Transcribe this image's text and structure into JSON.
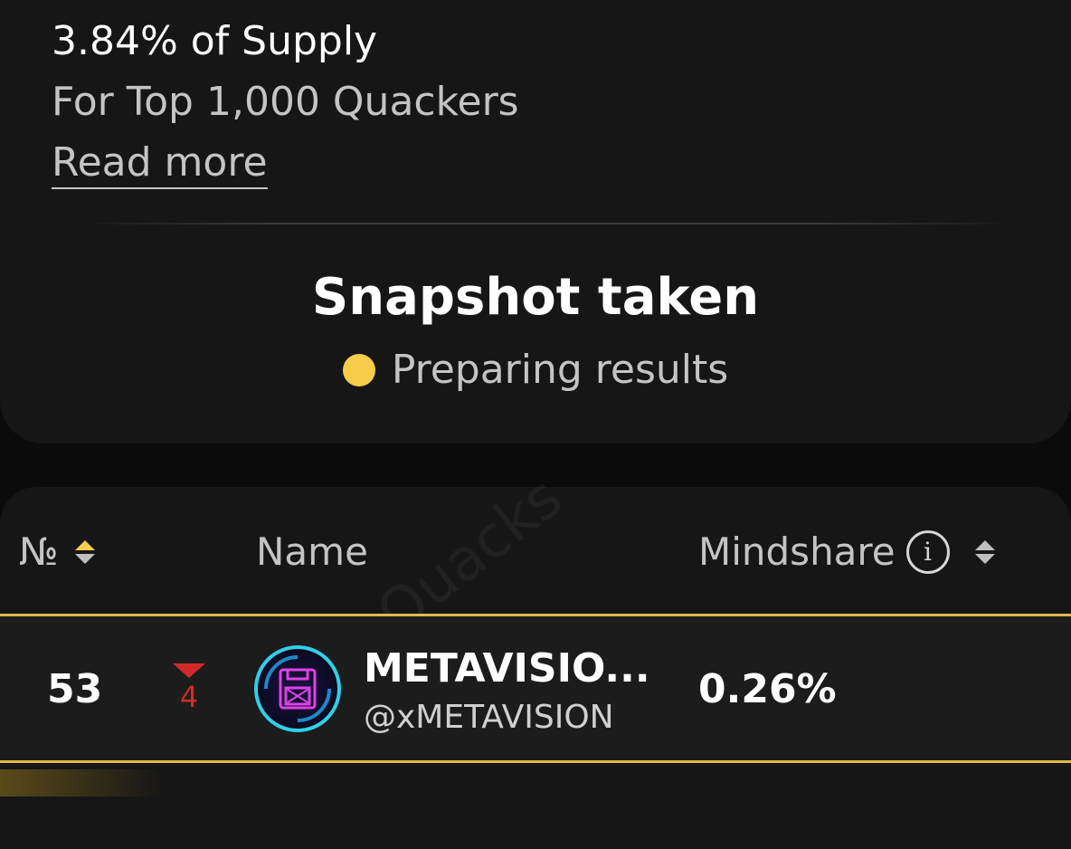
{
  "summary": {
    "supply_pct": "3.84% of Supply",
    "supply_sub": "For Top 1,000 Quackers",
    "read_more": "Read more"
  },
  "status": {
    "title": "Snapshot taken",
    "text": "Preparing results",
    "dot_color": "#f5cd4b"
  },
  "table": {
    "headers": {
      "rank": "№",
      "name": "Name",
      "mindshare": "Mindshare"
    },
    "rows": [
      {
        "rank": "53",
        "change": "4",
        "change_direction": "down",
        "name": "METAVISIO...",
        "handle": "@xMETAVISION",
        "mindshare": "0.26%",
        "avatar_icon": "floppy-disk-icon"
      }
    ]
  },
  "watermark": "Chain Quacks",
  "colors": {
    "accent": "#f5cd4b",
    "highlight_border": "#e0b84a",
    "negative": "#d22a2a"
  }
}
